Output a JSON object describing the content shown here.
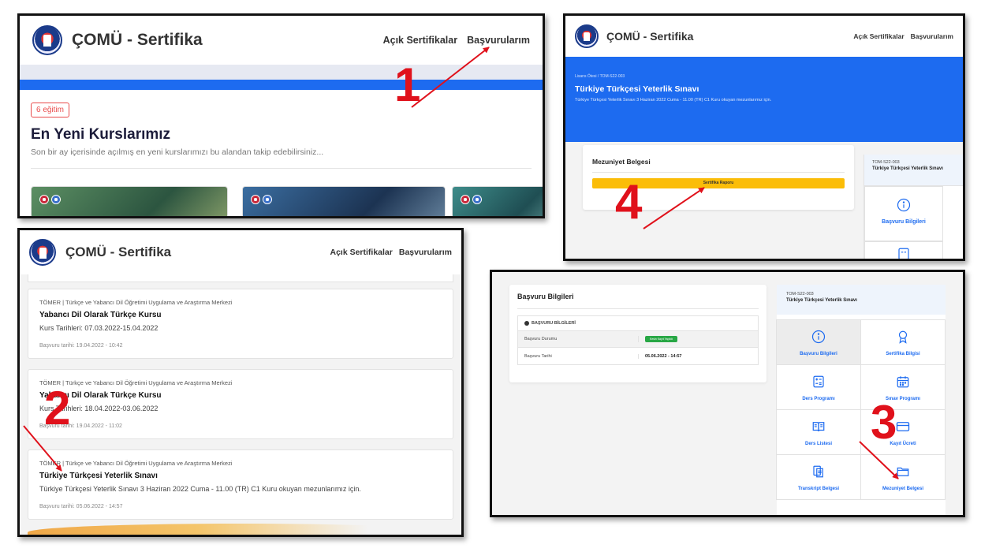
{
  "app": {
    "brand": "ÇOMÜ - Sertifika"
  },
  "nav": {
    "open_certs": "Açık Sertifikalar",
    "my_applications": "Başvurularım"
  },
  "panel1": {
    "badge": "6 eğitim",
    "heading": "En Yeni Kurslarımız",
    "subheading": "Son bir ay içerisinde açılmış en yeni kurslarımızı bu alandan takip edebilirsiniz..."
  },
  "panel2": {
    "applications": [
      {
        "org": "TÖMER | Türkçe ve Yabancı Dil Öğretimi Uygulama ve Araştırma Merkezi",
        "title": "Yabancı Dil Olarak Türkçe Kursu",
        "dates": "Kurs Tarihleri: 07.03.2022-15.04.2022",
        "applied": "Başvuru tarihi: 19.04.2022 - 10:42"
      },
      {
        "org": "TÖMER | Türkçe ve Yabancı Dil Öğretimi Uygulama ve Araştırma Merkezi",
        "title": "Yabancı Dil Olarak Türkçe Kursu",
        "dates": "Kurs Tarihleri: 18.04.2022-03.06.2022",
        "applied": "Başvuru tarihi: 19.04.2022 - 11:02"
      },
      {
        "org": "TÖMER | Türkçe ve Yabancı Dil Öğretimi Uygulama ve Araştırma Merkezi",
        "title": "Türkiye Türkçesi Yeterlik Sınavı",
        "dates": "Türkiye Türkçesi Yeterlik Sınavı 3 Haziran 2022 Cuma - 11.00 (TR) C1 Kuru okuyan mezunlarımız için.",
        "applied": "Başvuru tarihi: 05.06.2022 - 14:57"
      }
    ]
  },
  "panel3": {
    "breadcrumb": "Lisans Ötesi / TOM-S22-003",
    "hero_title": "Türkiye Türkçesi Yeterlik Sınavı",
    "hero_subtitle": "Türkiye Türkçesi Yeterlik Sınavı 3 Haziran 2022 Cuma - 11.00 (TR) C1 Kuru okuyan mezunlarımız için.",
    "card_title": "Mezuniyet Belgesi",
    "report_button": "Sertifika Raporu",
    "side_code": "TOM-S22-003",
    "side_title": "Türkiye Türkçesi Yeterlik Sınavı",
    "tile": "Başvuru Bilgileri"
  },
  "panel4": {
    "card_title": "Başvuru Bilgileri",
    "table_header": "BAŞVURU BİLGİLERİ",
    "rows": [
      {
        "label": "Başvuru Durumu",
        "value": "Kesin Kayıt Yapıldı"
      },
      {
        "label": "Başvuru Tarihi",
        "value": "05.06.2022 - 14:57"
      }
    ],
    "side_code": "TOM-S22-003",
    "side_title": "Türkiye Türkçesi Yeterlik Sınavı",
    "tiles": [
      {
        "label": "Başvuru Bilgileri",
        "icon": "info-icon"
      },
      {
        "label": "Sertifika Bilgisi",
        "icon": "award-icon"
      },
      {
        "label": "Ders Programı",
        "icon": "calculator-icon"
      },
      {
        "label": "Sınav Programı",
        "icon": "calendar-icon"
      },
      {
        "label": "Ders Listesi",
        "icon": "book-icon"
      },
      {
        "label": "Kayıt Ücreti",
        "icon": "card-icon"
      },
      {
        "label": "Transkript Belgesi",
        "icon": "documents-icon"
      },
      {
        "label": "Mezuniyet Belgesi",
        "icon": "folder-icon"
      }
    ]
  },
  "steps": [
    "1",
    "2",
    "3",
    "4"
  ],
  "colors": {
    "primary_blue": "#1d6bf0",
    "annotation_red": "#e0111b",
    "warning_yellow": "#fbbd08",
    "success_green": "#28a745"
  }
}
